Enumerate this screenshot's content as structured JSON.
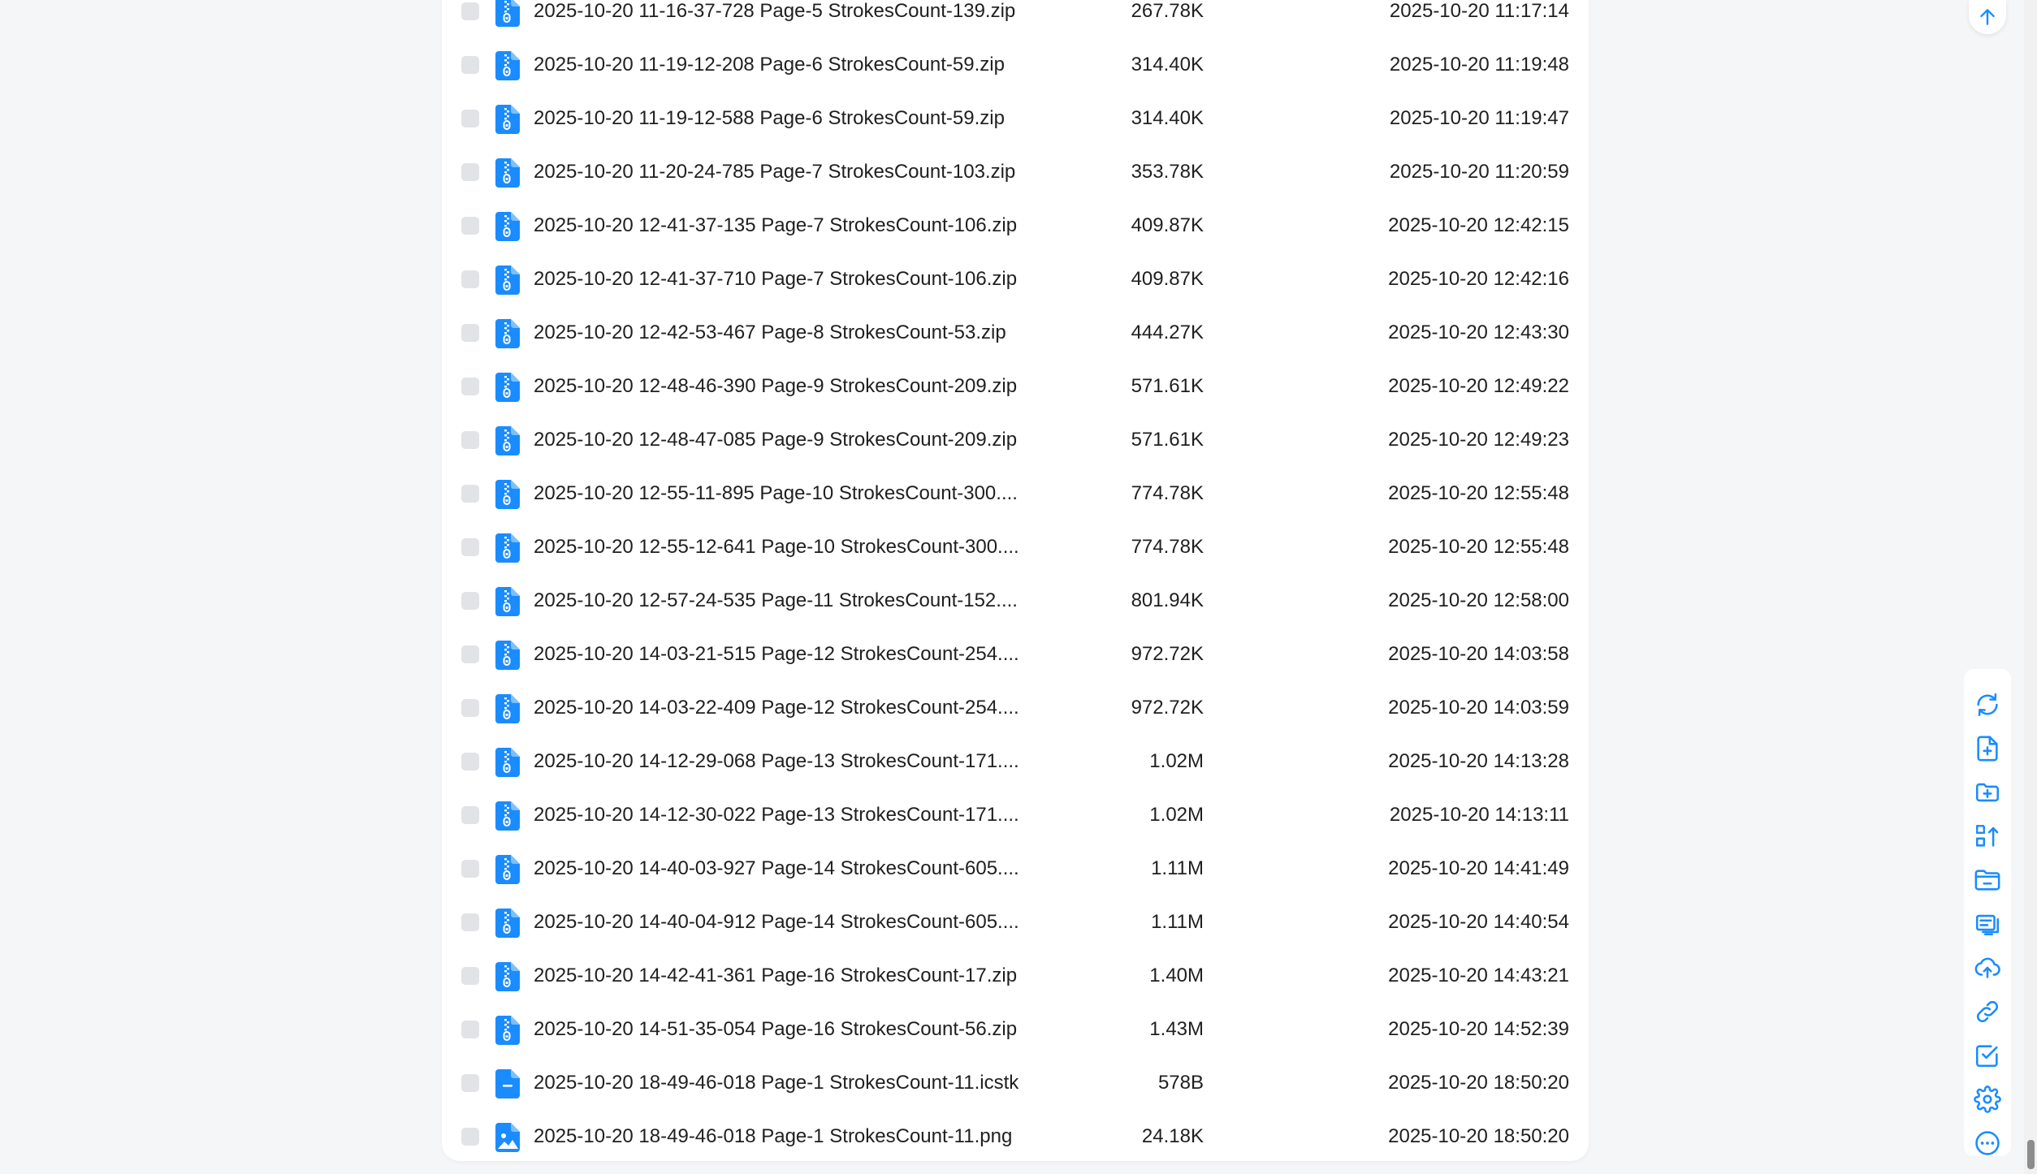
{
  "files": [
    {
      "name": "2025-10-20 11-16-37-728 Page-5 StrokesCount-139.zip",
      "size": "267.78K",
      "modified": "2025-10-20 11:17:14",
      "icon": "zip-file-icon"
    },
    {
      "name": "2025-10-20 11-19-12-208 Page-6 StrokesCount-59.zip",
      "size": "314.40K",
      "modified": "2025-10-20 11:19:48",
      "icon": "zip-file-icon"
    },
    {
      "name": "2025-10-20 11-19-12-588 Page-6 StrokesCount-59.zip",
      "size": "314.40K",
      "modified": "2025-10-20 11:19:47",
      "icon": "zip-file-icon"
    },
    {
      "name": "2025-10-20 11-20-24-785 Page-7 StrokesCount-103.zip",
      "size": "353.78K",
      "modified": "2025-10-20 11:20:59",
      "icon": "zip-file-icon"
    },
    {
      "name": "2025-10-20 12-41-37-135 Page-7 StrokesCount-106.zip",
      "size": "409.87K",
      "modified": "2025-10-20 12:42:15",
      "icon": "zip-file-icon"
    },
    {
      "name": "2025-10-20 12-41-37-710 Page-7 StrokesCount-106.zip",
      "size": "409.87K",
      "modified": "2025-10-20 12:42:16",
      "icon": "zip-file-icon"
    },
    {
      "name": "2025-10-20 12-42-53-467 Page-8 StrokesCount-53.zip",
      "size": "444.27K",
      "modified": "2025-10-20 12:43:30",
      "icon": "zip-file-icon"
    },
    {
      "name": "2025-10-20 12-48-46-390 Page-9 StrokesCount-209.zip",
      "size": "571.61K",
      "modified": "2025-10-20 12:49:22",
      "icon": "zip-file-icon"
    },
    {
      "name": "2025-10-20 12-48-47-085 Page-9 StrokesCount-209.zip",
      "size": "571.61K",
      "modified": "2025-10-20 12:49:23",
      "icon": "zip-file-icon"
    },
    {
      "name": "2025-10-20 12-55-11-895 Page-10 StrokesCount-300....",
      "size": "774.78K",
      "modified": "2025-10-20 12:55:48",
      "icon": "zip-file-icon"
    },
    {
      "name": "2025-10-20 12-55-12-641 Page-10 StrokesCount-300....",
      "size": "774.78K",
      "modified": "2025-10-20 12:55:48",
      "icon": "zip-file-icon"
    },
    {
      "name": "2025-10-20 12-57-24-535 Page-11 StrokesCount-152....",
      "size": "801.94K",
      "modified": "2025-10-20 12:58:00",
      "icon": "zip-file-icon"
    },
    {
      "name": "2025-10-20 14-03-21-515 Page-12 StrokesCount-254....",
      "size": "972.72K",
      "modified": "2025-10-20 14:03:58",
      "icon": "zip-file-icon"
    },
    {
      "name": "2025-10-20 14-03-22-409 Page-12 StrokesCount-254....",
      "size": "972.72K",
      "modified": "2025-10-20 14:03:59",
      "icon": "zip-file-icon"
    },
    {
      "name": "2025-10-20 14-12-29-068 Page-13 StrokesCount-171....",
      "size": "1.02M",
      "modified": "2025-10-20 14:13:28",
      "icon": "zip-file-icon"
    },
    {
      "name": "2025-10-20 14-12-30-022 Page-13 StrokesCount-171....",
      "size": "1.02M",
      "modified": "2025-10-20 14:13:11",
      "icon": "zip-file-icon"
    },
    {
      "name": "2025-10-20 14-40-03-927 Page-14 StrokesCount-605....",
      "size": "1.11M",
      "modified": "2025-10-20 14:41:49",
      "icon": "zip-file-icon"
    },
    {
      "name": "2025-10-20 14-40-04-912 Page-14 StrokesCount-605....",
      "size": "1.11M",
      "modified": "2025-10-20 14:40:54",
      "icon": "zip-file-icon"
    },
    {
      "name": "2025-10-20 14-42-41-361 Page-16 StrokesCount-17.zip",
      "size": "1.40M",
      "modified": "2025-10-20 14:43:21",
      "icon": "zip-file-icon"
    },
    {
      "name": "2025-10-20 14-51-35-054 Page-16 StrokesCount-56.zip",
      "size": "1.43M",
      "modified": "2025-10-20 14:52:39",
      "icon": "zip-file-icon"
    },
    {
      "name": "2025-10-20 18-49-46-018 Page-1 StrokesCount-11.icstk",
      "size": "578B",
      "modified": "2025-10-20 18:50:20",
      "icon": "document-file-icon"
    },
    {
      "name": "2025-10-20 18-49-46-018 Page-1 StrokesCount-11.png",
      "size": "24.18K",
      "modified": "2025-10-20 18:50:20",
      "icon": "image-file-icon"
    }
  ],
  "toolbar": [
    {
      "icon": "refresh-icon"
    },
    {
      "icon": "new-file-icon"
    },
    {
      "icon": "new-folder-icon"
    },
    {
      "icon": "sort-icon"
    },
    {
      "icon": "folder-collapse-icon"
    },
    {
      "icon": "multi-window-icon"
    },
    {
      "icon": "upload-cloud-icon"
    },
    {
      "icon": "link-icon"
    },
    {
      "icon": "select-checkbox-icon"
    },
    {
      "icon": "settings-gear-icon"
    },
    {
      "icon": "more-options-icon"
    }
  ],
  "colors": {
    "accent": "#1a8cff",
    "checkbox": "#e2e3e7",
    "text": "#1f1f1f",
    "background": "#f5f6f8"
  }
}
